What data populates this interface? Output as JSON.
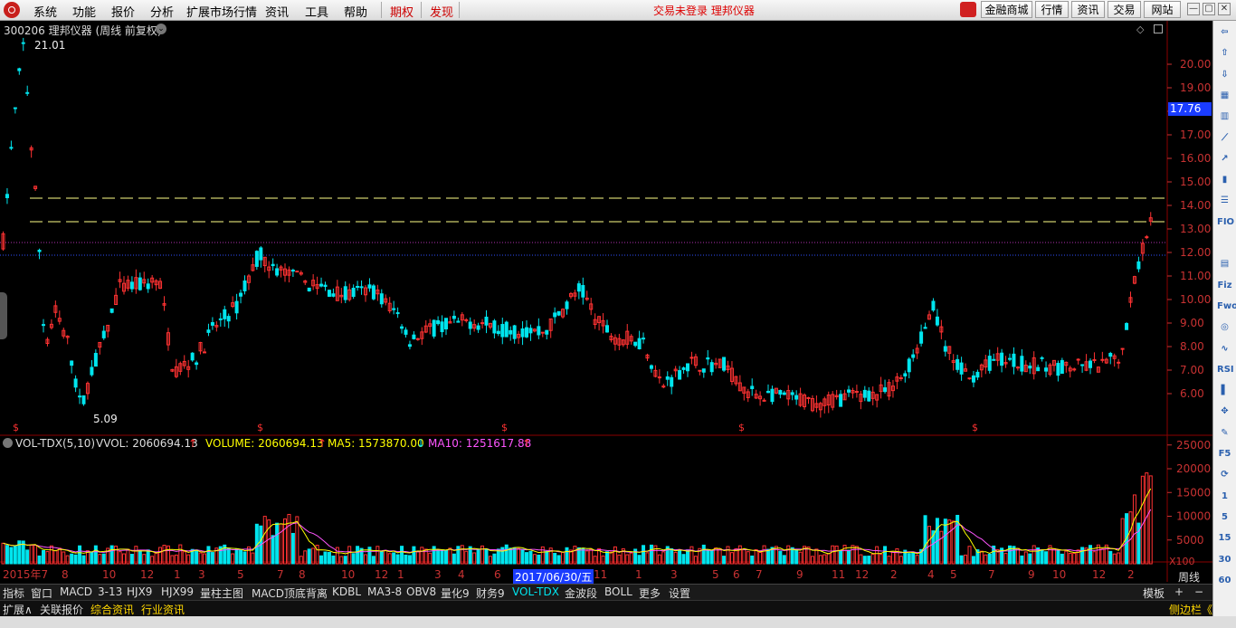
{
  "menubar": {
    "items": [
      "系统",
      "功能",
      "报价",
      "分析",
      "扩展市场行情",
      "资讯",
      "工具",
      "帮助"
    ],
    "red_items": [
      "期权",
      "发现"
    ],
    "status": "交易未登录  理邦仪器",
    "shop_label": "金融商城",
    "buttons": [
      "行情",
      "资讯",
      "交易",
      "网站"
    ],
    "window_controls": [
      "—",
      "▢",
      "✕"
    ]
  },
  "chart": {
    "title": "300206 理邦仪器 (周线 前复权)",
    "high_label": "21.01",
    "low_label": "5.09",
    "current_price_tag": "17.76",
    "price_axis": [
      "20.00",
      "19.00",
      "18.00",
      "17.00",
      "16.00",
      "15.00",
      "14.00",
      "13.00",
      "12.00",
      "11.00",
      "10.00",
      "9.00",
      "8.00",
      "7.00",
      "6.00"
    ],
    "volume_indicator": {
      "name": "VOL-TDX(5,10)",
      "vvol": "VVOL: 2060694.13",
      "volume": "VOLUME: 2060694.13",
      "ma5": "MA5: 1573870.00",
      "ma10": "MA10: 1251617.88"
    },
    "volume_axis": [
      "25000",
      "20000",
      "15000",
      "10000",
      "5000"
    ],
    "volume_unit": "X100",
    "period_label": "周线",
    "date_labels": [
      "2015年7",
      "8",
      "10",
      "12",
      "1",
      "3",
      "5",
      "7",
      "8",
      "10",
      "12",
      "1",
      "3",
      "4",
      "6",
      "11",
      "1",
      "3",
      "5",
      "6",
      "7",
      "9",
      "11",
      "12",
      "2",
      "4",
      "5",
      "7",
      "9",
      "10",
      "12",
      "2"
    ],
    "cursor_date": "2017/06/30/五",
    "colors": {
      "up": "#ff3232",
      "down": "#00e5ee",
      "ma5": "#ffff00",
      "ma10": "#ff55ff",
      "grid": "#8b0000",
      "axis_text": "#c83232"
    }
  },
  "bottom_tabs": [
    "指标",
    "窗口",
    "MACD",
    "3-13",
    "HJX9",
    "HJX99",
    "量柱主图",
    "MACD顶底背离",
    "KDBL",
    "MA3-8",
    "OBV8",
    "量化9",
    "财务9",
    "VOL-TDX",
    "金波段",
    "BOLL",
    "更多",
    "设置"
  ],
  "active_tab": "VOL-TDX",
  "template_label": "模板",
  "info_tabs": [
    "扩展∧",
    "关联报价",
    "综合资讯",
    "行业资讯"
  ],
  "sidebar_label": "侧边栏《",
  "sidebar_icons": [
    "arrow-left-icon",
    "arrow-up-icon",
    "arrow-down-icon",
    "grid-icon",
    "kline-icon",
    "line-icon",
    "trend-icon",
    "candle-icon",
    "list-icon",
    "f10-icon",
    "finance-icon",
    "book-icon",
    "fiz-icon",
    "fwo-icon",
    "circle-icon",
    "wave-icon",
    "rsi-icon",
    "bar-icon",
    "move-icon",
    "pen-icon",
    "f5-icon",
    "refresh-icon",
    "one-icon",
    "five-icon",
    "fifteen-icon",
    "thirty-icon",
    "sixty-icon"
  ],
  "sidebar_texts": [
    "",
    "",
    "",
    "",
    "",
    "",
    "",
    "",
    "",
    "FIO",
    "",
    "",
    "Fiz",
    "Fwo",
    "",
    "",
    "RSI",
    "",
    "",
    "",
    "F5",
    "",
    "1",
    "5",
    "15",
    "30",
    "60"
  ]
}
